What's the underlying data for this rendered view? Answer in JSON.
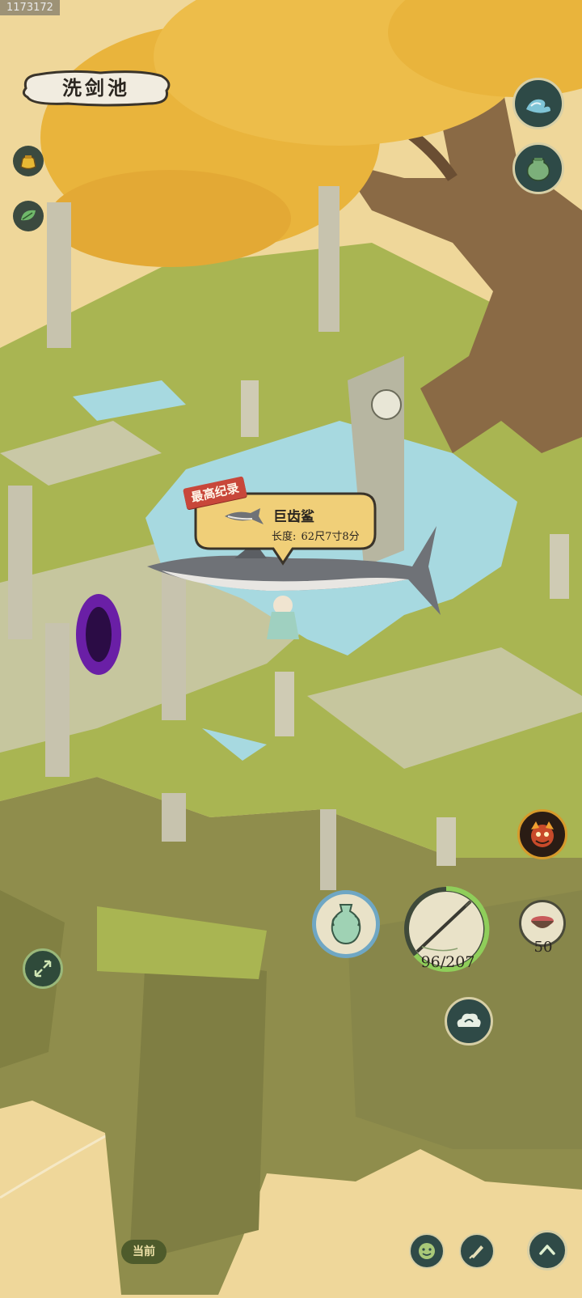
{
  "debug_id": "1173172",
  "location_title": "洗剑池",
  "catch_bubble": {
    "record_tag": "最高纪录",
    "fish_name": "巨齿鲨",
    "length_label": "长度:",
    "length_value": "62尺7寸8分"
  },
  "hud": {
    "rod_durability": "96/207",
    "bait_count": "50",
    "current_label": "当前"
  },
  "colors": {
    "sky": "#efd79a",
    "foliage": "#e9b43c",
    "grass": "#a9b552",
    "cliff": "#8f8d4c",
    "water": "#a7d9e0",
    "button_ring": "#6fa7c4",
    "record_red": "#c8473a"
  },
  "icons": {
    "wave": "wave-icon",
    "jar": "jar-icon",
    "pouch": "pouch-icon",
    "leaf": "leaf-icon",
    "expand": "expand-icon",
    "vase": "vase-icon",
    "rod": "fishing-rod-icon",
    "bait": "bait-bowl-icon",
    "demon": "demon-mask-icon",
    "cloud": "cloud-icon",
    "face": "face-icon",
    "brush": "brush-icon",
    "up": "chevron-up-icon"
  }
}
